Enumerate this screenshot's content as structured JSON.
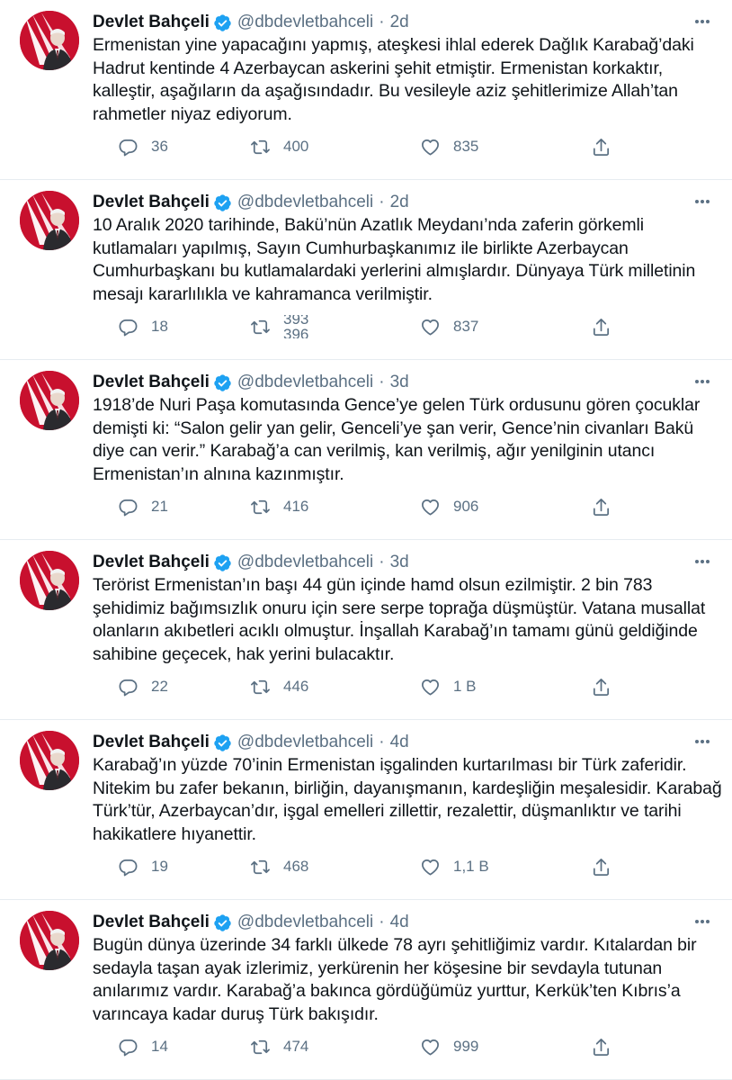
{
  "tweets": [
    {
      "name": "Devlet Bahçeli",
      "handle": "@dbdevletbahceli",
      "separator": "·",
      "time": "2d",
      "text": "Ermenistan yine yapacağını yapmış, ateşkesi ihlal ederek Dağlık Karabağ’daki Hadrut kentinde 4 Azerbaycan askerini şehit etmiştir. Ermenistan korkaktır, kalleştir, aşağıların da aşağısındadır. Bu vesileyle aziz şehitlerimize Allah’tan rahmetler niyaz ediyorum.",
      "replies": "36",
      "retweets": "400",
      "likes": "835"
    },
    {
      "name": "Devlet Bahçeli",
      "handle": "@dbdevletbahceli",
      "separator": "·",
      "time": "2d",
      "text": "10 Aralık 2020 tarihinde, Bakü’nün Azatlık Meydanı’nda zaferin görkemli kutlamaları yapılmış, Sayın Cumhurbaşkanımız ile birlikte Azerbaycan Cumhurbaşkanı bu kutlamalardaki yerlerini almışlardır. Dünyaya Türk milletinin mesajı kararlılıkla ve kahramanca verilmiştir.",
      "replies": "18",
      "retweets": "393",
      "retweets_next": "396",
      "likes": "837"
    },
    {
      "name": "Devlet Bahçeli",
      "handle": "@dbdevletbahceli",
      "separator": "·",
      "time": "3d",
      "text": "1918’de Nuri Paşa komutasında Gence’ye gelen Türk ordusunu gören çocuklar demişti ki: “Salon gelir yan gelir, Genceli’ye şan verir, Gence’nin civanları Bakü diye can verir.” Karabağ’a can verilmiş, kan verilmiş, ağır yenilginin utancı Ermenistan’ın alnına kazınmıştır.",
      "replies": "21",
      "retweets": "416",
      "likes": "906"
    },
    {
      "name": "Devlet Bahçeli",
      "handle": "@dbdevletbahceli",
      "separator": "·",
      "time": "3d",
      "text": "Terörist Ermenistan’ın başı 44 gün içinde hamd olsun ezilmiştir. 2 bin 783 şehidimiz bağımsızlık onuru için sere serpe toprağa düşmüştür. Vatana musallat olanların akıbetleri acıklı olmuştur. İnşallah Karabağ’ın tamamı günü geldiğinde sahibine geçecek, hak yerini bulacaktır.",
      "replies": "22",
      "retweets": "446",
      "likes": "1 B"
    },
    {
      "name": "Devlet Bahçeli",
      "handle": "@dbdevletbahceli",
      "separator": "·",
      "time": "4d",
      "text": "Karabağ’ın yüzde 70’inin Ermenistan işgalinden kurtarılması bir Türk zaferidir. Nitekim bu zafer bekanın, birliğin, dayanışmanın, kardeşliğin meşalesidir. Karabağ Türk’tür, Azerbaycan’dır, işgal emelleri zillettir, rezalettir, düşmanlıktır ve tarihi hakikatlere hıyanettir.",
      "replies": "19",
      "retweets": "468",
      "likes": "1,1 B"
    },
    {
      "name": "Devlet Bahçeli",
      "handle": "@dbdevletbahceli",
      "separator": "·",
      "time": "4d",
      "text": "Bugün dünya üzerinde 34 farklı ülkede 78 ayrı şehitliğimiz vardır. Kıtalardan bir sedayla taşan ayak izlerimiz, yerkürenin her köşesine bir sevdayla tutunan anılarımız vardır. Karabağ’a bakınca gördüğümüz yurttur, Kerkük’ten Kıbrıs’a varıncaya kadar duruş Türk bakışıdır.",
      "replies": "14",
      "retweets": "474",
      "likes": "999"
    }
  ],
  "colors": {
    "text": "#0f1419",
    "muted": "#5b7083",
    "verified": "#1da1f2",
    "divider": "#e6ecf0",
    "avatar_red": "#c8102e"
  },
  "icons": {
    "reply": "reply-icon",
    "retweet": "retweet-icon",
    "like": "heart-icon",
    "share": "share-icon",
    "more": "more-icon",
    "verified": "verified-badge-icon"
  }
}
